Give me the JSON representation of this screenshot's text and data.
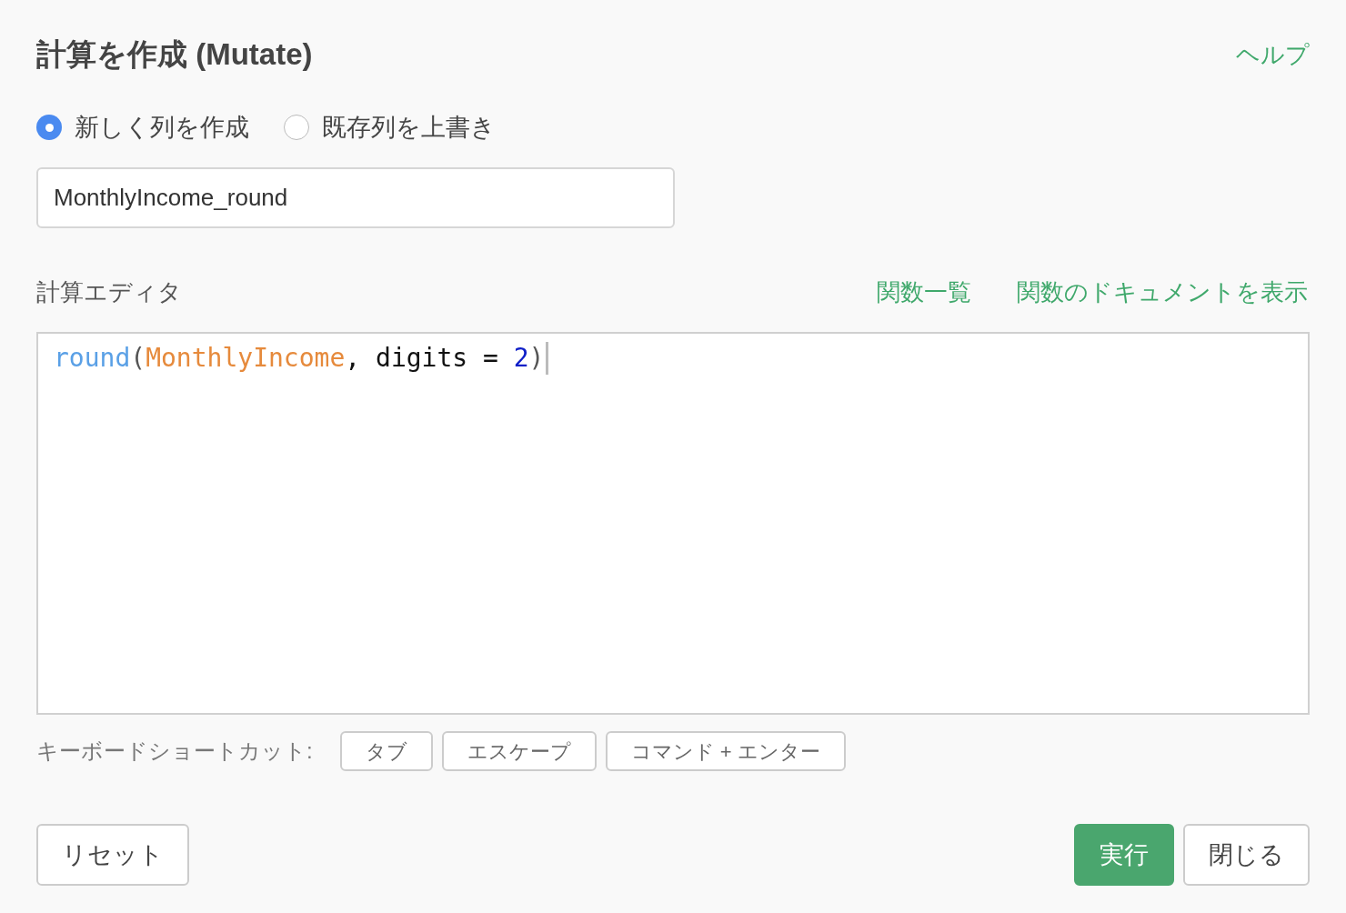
{
  "title": "計算を作成 (Mutate)",
  "help_link": "ヘルプ",
  "mode_options": [
    {
      "label": "新しく列を作成",
      "selected": true
    },
    {
      "label": "既存列を上書き",
      "selected": false
    }
  ],
  "column_name": {
    "value": "MonthlyIncome_round"
  },
  "editor": {
    "label": "計算エディタ",
    "links": [
      "関数一覧",
      "関数のドキュメントを表示"
    ],
    "code": [
      {
        "kind": "function",
        "text": "round"
      },
      {
        "kind": "punct",
        "text": "("
      },
      {
        "kind": "column",
        "text": "MonthlyIncome"
      },
      {
        "kind": "plain",
        "text": ", digits = "
      },
      {
        "kind": "number",
        "text": "2"
      },
      {
        "kind": "punct",
        "text": ")"
      }
    ]
  },
  "shortcuts": {
    "label": "キーボードショートカット:",
    "keys": [
      "タブ",
      "エスケープ",
      "コマンド + エンター"
    ]
  },
  "buttons": [
    {
      "kind": "secondary",
      "label": "リセット"
    },
    {
      "kind": "primary",
      "label": "実行"
    },
    {
      "kind": "secondary",
      "label": "閉じる"
    }
  ]
}
